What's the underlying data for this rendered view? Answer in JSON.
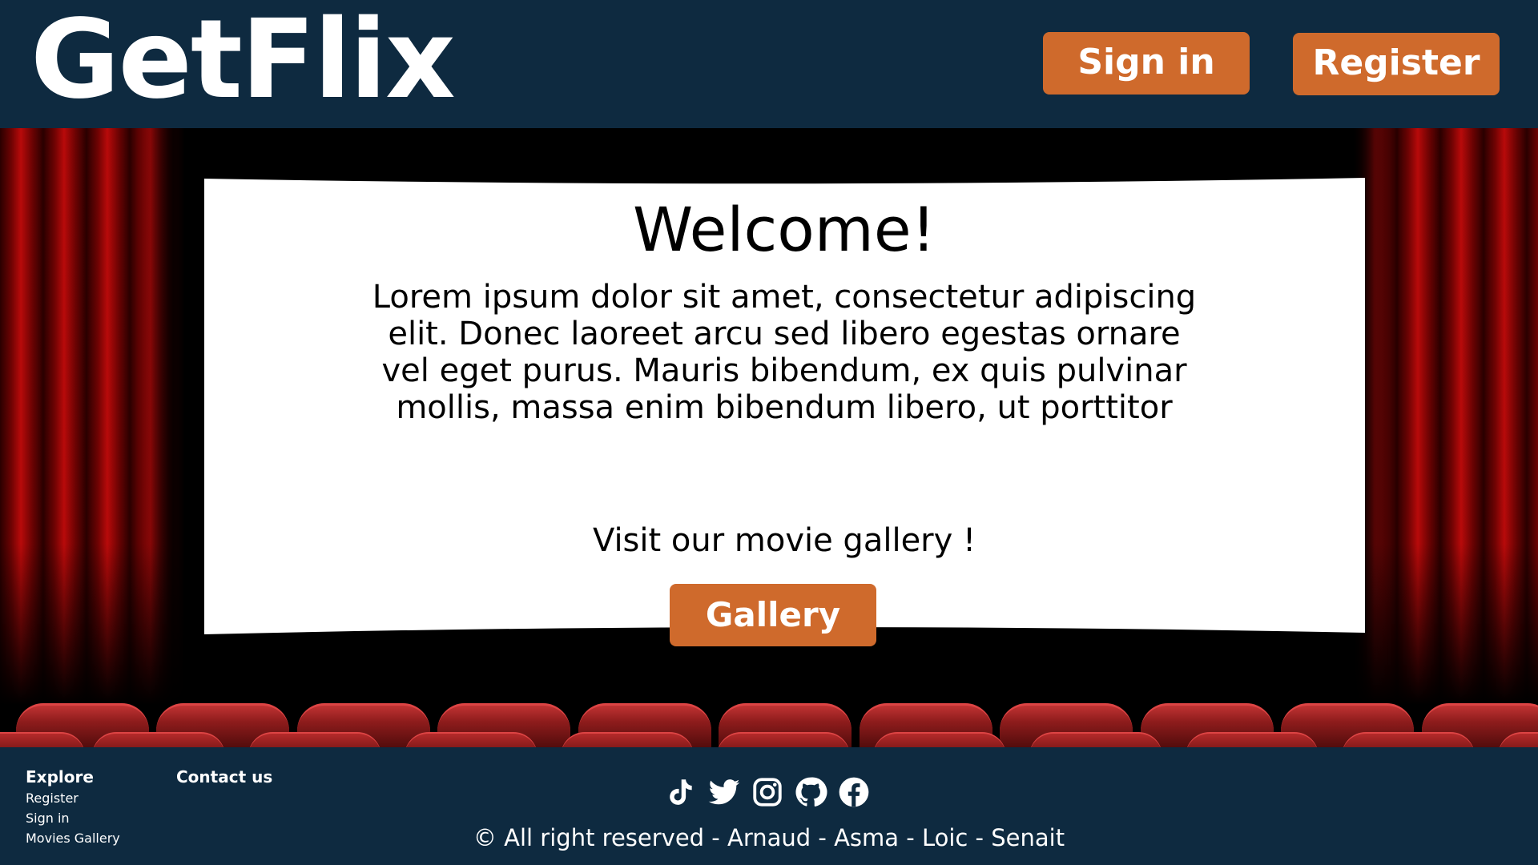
{
  "header": {
    "logo": "GetFlix",
    "signin_label": "Sign in",
    "register_label": "Register"
  },
  "screen": {
    "title": "Welcome!",
    "body": "Lorem ipsum dolor sit amet, consectetur adipiscing elit. Donec laoreet arcu sed libero egestas ornare vel eget purus. Mauris bibendum, ex quis pulvinar mollis, massa enim bibendum libero, ut porttitor",
    "visit_text": "Visit our movie gallery !",
    "gallery_label": "Gallery"
  },
  "footer": {
    "explore_title": "Explore",
    "explore_links": [
      "Register",
      "Sign in",
      "Movies Gallery"
    ],
    "contact_title": "Contact us",
    "social_icons": [
      "tiktok-icon",
      "twitter-icon",
      "instagram-icon",
      "github-icon",
      "facebook-icon"
    ],
    "copyright": "© All right reserved - Arnaud - Asma - Loic - Senait"
  },
  "colors": {
    "header_bg": "#0e2a40",
    "accent": "#cf6a2c",
    "curtain_red": "#b80a0a",
    "seat_red": "#8e1c1c"
  }
}
